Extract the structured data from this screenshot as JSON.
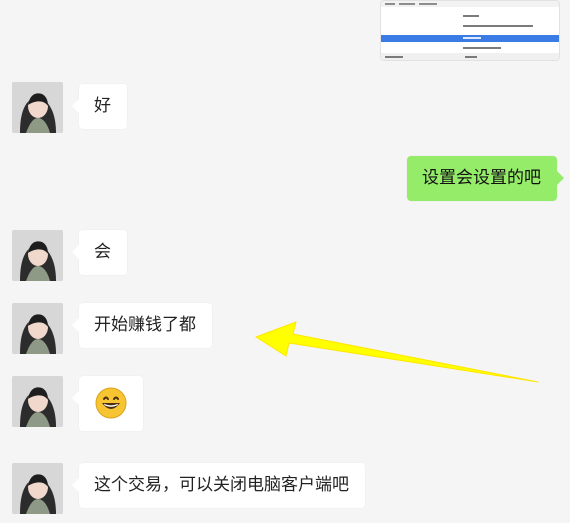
{
  "chat": {
    "screenshot_thumbnail": {
      "alt": "settings menu screenshot"
    },
    "messages": [
      {
        "from": "contact",
        "text": "好"
      },
      {
        "from": "me",
        "text": "设置会设置的吧"
      },
      {
        "from": "contact",
        "text": "会"
      },
      {
        "from": "contact",
        "text": "开始赚钱了都"
      },
      {
        "from": "contact",
        "emoji": "grinning-face"
      },
      {
        "from": "contact",
        "text": "这个交易，可以关闭电脑客户端吧"
      }
    ]
  },
  "colors": {
    "background": "#f5f5f5",
    "incoming_bubble": "#ffffff",
    "outgoing_bubble": "#95ec69",
    "highlight_arrow": "#ffff00"
  }
}
